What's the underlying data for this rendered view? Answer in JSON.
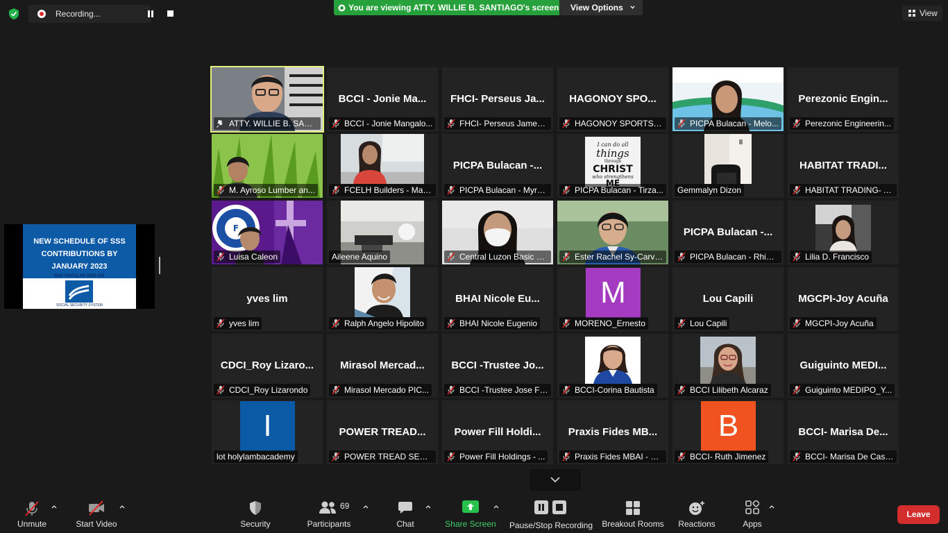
{
  "recording": {
    "label": "Recording..."
  },
  "banner": {
    "viewing_text": "You are viewing ATTY. WILLIE B. SANTIAGO's screen",
    "view_options": "View Options"
  },
  "view_button": {
    "label": "View"
  },
  "shared_slide": {
    "title_line1": "NEW SCHEDULE OF SSS",
    "title_line2": "CONTRIBUTIONS BY",
    "title_line3": "JANUARY 2023",
    "circular": "SSS CIRCULAR 2022-033",
    "org": "SOCIAL SECURITY SYSTEM"
  },
  "tiles": [
    {
      "label": "ATTY. WILLIE B. SANTIAGO",
      "big": "",
      "photo": "man-glasses",
      "pinned": true,
      "active": true
    },
    {
      "label": "BCCI - Jonie Mangalo...",
      "big": "BCCI - Jonie Ma...",
      "photo": ""
    },
    {
      "label": "FHCI- Perseus James ...",
      "big": "FHCI- Perseus Ja...",
      "photo": ""
    },
    {
      "label": "HAGONOY SPORTS I...",
      "big": "HAGONOY SPO...",
      "photo": ""
    },
    {
      "label": "PICPA Bulacan - Melo...",
      "big": "",
      "photo": "woman-banner"
    },
    {
      "label": "Perezonic Engineerin...",
      "big": "Perezonic Engin...",
      "photo": ""
    },
    {
      "label": "M. Ayroso Lumber an...",
      "big": "",
      "photo": "grass"
    },
    {
      "label": "FCELH Builders - Mari...",
      "big": "",
      "photo": "office-woman"
    },
    {
      "label": "PICPA Bulacan - Myra...",
      "big": "PICPA Bulacan -...",
      "photo": ""
    },
    {
      "label": "PICPA Bulacan - Tirza...",
      "big": "",
      "photo": "christ-poster"
    },
    {
      "label": "Gemmalyn Dizon",
      "big": "",
      "photo": "room-chair",
      "muted": false
    },
    {
      "label": "HABITAT TRADING- Ai...",
      "big": "HABITAT TRADI...",
      "photo": ""
    },
    {
      "label": "Luisa Caleon",
      "big": "",
      "photo": "purple-cross"
    },
    {
      "label": "Aileene Aquino",
      "big": "",
      "photo": "office-desk",
      "muted": false
    },
    {
      "label": "Central Luzon Basic H...",
      "big": "",
      "photo": "woman-mask"
    },
    {
      "label": "Ester Rachel Sy-Carva...",
      "big": "",
      "photo": "woman-glasses-blue"
    },
    {
      "label": "PICPA Bulacan - Rhina...",
      "big": "PICPA Bulacan -...",
      "photo": ""
    },
    {
      "label": "Lilia D. Francisco",
      "big": "",
      "photo": "woman-car"
    },
    {
      "label": "yves lim",
      "big": "yves lim",
      "photo": ""
    },
    {
      "label": "Ralph Angelo Hipolito",
      "big": "",
      "photo": "man-smile"
    },
    {
      "label": "BHAI Nicole Eugenio",
      "big": "BHAI Nicole Eu...",
      "photo": ""
    },
    {
      "label": "MORENO_Ernesto",
      "big": "",
      "photo": "letter",
      "letter": "M",
      "letter_bg": "#a53bc0"
    },
    {
      "label": "Lou  Capili",
      "big": "Lou  Capili",
      "photo": ""
    },
    {
      "label": "MGCPI-Joy Acuña",
      "big": "MGCPI-Joy Acuña",
      "photo": ""
    },
    {
      "label": "CDCI_Roy Lizarondo",
      "big": "CDCI_Roy  Lizaro...",
      "photo": ""
    },
    {
      "label": "Mirasol Mercado PIC...",
      "big": "Mirasol  Mercad...",
      "photo": ""
    },
    {
      "label": "BCCI -Trustee Jose Fr...",
      "big": "BCCI -Trustee Jo...",
      "photo": ""
    },
    {
      "label": "BCCI-Corina Bautista",
      "big": "",
      "photo": "woman-portrait"
    },
    {
      "label": "BCCI Lilibeth Alcaraz",
      "big": "",
      "photo": "woman-glasses-outdoor"
    },
    {
      "label": "Guiguinto MEDIPO_Y...",
      "big": "Guiguinto  MEDI...",
      "photo": ""
    },
    {
      "label": "lot holylambacademy",
      "big": "",
      "photo": "letter",
      "letter": "I",
      "letter_bg": "#0b5aa5",
      "muted": false
    },
    {
      "label": "POWER TREAD SERVI...",
      "big": "POWER  TREAD...",
      "photo": ""
    },
    {
      "label": "Power Fill Holdings - ...",
      "big": "Power  Fill  Holdi...",
      "photo": ""
    },
    {
      "label": "Praxis Fides MBAI - El...",
      "big": "Praxis  Fides  MB...",
      "photo": ""
    },
    {
      "label": "BCCI- Ruth Jimenez",
      "big": "",
      "photo": "letter",
      "letter": "B",
      "letter_bg": "#f0531f"
    },
    {
      "label": "BCCI- Marisa De Cast...",
      "big": "BCCI- Marisa De...",
      "photo": ""
    }
  ],
  "toolbar": {
    "unmute": "Unmute",
    "start_video": "Start Video",
    "security": "Security",
    "participants": "Participants",
    "participants_count": "69",
    "chat": "Chat",
    "share_screen": "Share Screen",
    "pause_stop": "Pause/Stop Recording",
    "breakout": "Breakout Rooms",
    "reactions": "Reactions",
    "apps": "Apps",
    "leave": "Leave"
  },
  "colors": {
    "share_green": "#26a13b",
    "leave_red": "#d42d2d",
    "active_speaker": "#e6f07d"
  }
}
